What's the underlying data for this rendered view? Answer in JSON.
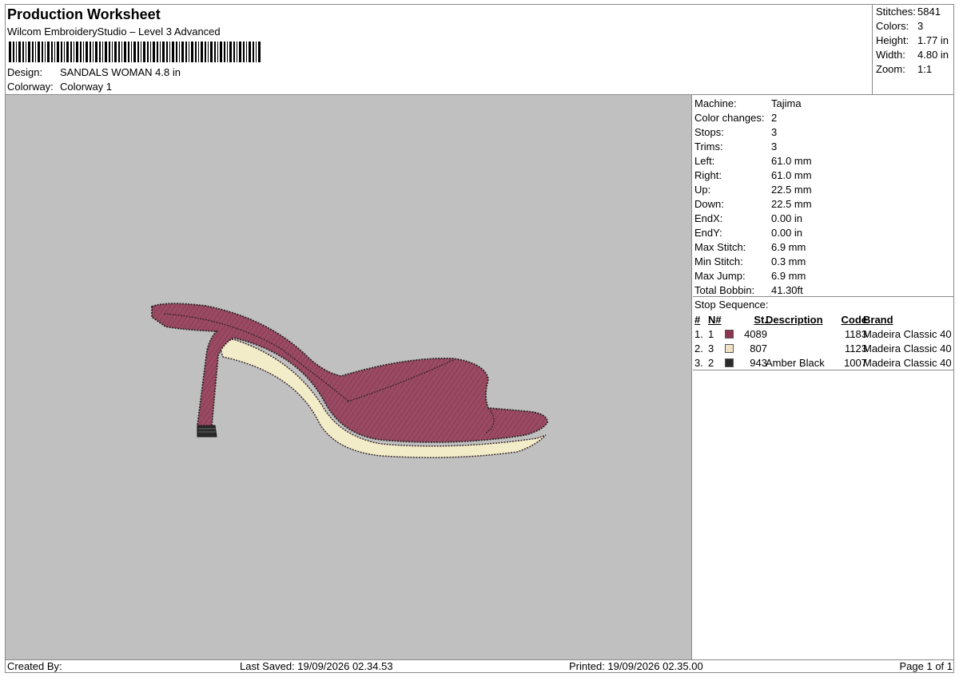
{
  "header": {
    "title": "Production Worksheet",
    "subtitle": "Wilcom EmbroideryStudio – Level 3 Advanced",
    "design_label": "Design:",
    "design_value": "SANDALS WOMAN 4.8 in",
    "colorway_label": "Colorway:",
    "colorway_value": "Colorway 1"
  },
  "summary": [
    {
      "label": "Stitches:",
      "value": "5841"
    },
    {
      "label": "Colors:",
      "value": "3"
    },
    {
      "label": "Height:",
      "value": "1.77 in"
    },
    {
      "label": "Width:",
      "value": "4.80 in"
    },
    {
      "label": "Zoom:",
      "value": "1:1"
    }
  ],
  "specs": [
    {
      "label": "Machine:",
      "value": "Tajima"
    },
    {
      "label": "Color changes:",
      "value": "2"
    },
    {
      "label": "Stops:",
      "value": "3"
    },
    {
      "label": "Trims:",
      "value": "3"
    },
    {
      "label": "Left:",
      "value": "61.0 mm"
    },
    {
      "label": "Right:",
      "value": "61.0 mm"
    },
    {
      "label": "Up:",
      "value": "22.5 mm"
    },
    {
      "label": "Down:",
      "value": "22.5 mm"
    },
    {
      "label": "EndX:",
      "value": "0.00 in"
    },
    {
      "label": "EndY:",
      "value": "0.00 in"
    },
    {
      "label": "Max Stitch:",
      "value": "6.9 mm"
    },
    {
      "label": "Min Stitch:",
      "value": "0.3 mm"
    },
    {
      "label": "Max Jump:",
      "value": "6.9 mm"
    },
    {
      "label": "Total Bobbin:",
      "value": "41.30ft"
    }
  ],
  "stop_sequence": {
    "title": "Stop Sequence:",
    "headers": {
      "idx": "#",
      "n": "N#",
      "st": "St.",
      "desc": "Description",
      "code": "Code",
      "brand": "Brand"
    },
    "rows": [
      {
        "idx": "1.",
        "n": "1",
        "color": "#8e3550",
        "st": "4089",
        "desc": "",
        "code": "1183",
        "brand": "Madeira Classic 40"
      },
      {
        "idx": "2.",
        "n": "3",
        "color": "#f0e2c6",
        "st": "807",
        "desc": "",
        "code": "1123",
        "brand": "Madeira Classic 40"
      },
      {
        "idx": "3.",
        "n": "2",
        "color": "#2a2a2a",
        "st": "943",
        "desc": "Amber Black",
        "code": "1007",
        "brand": "Madeira Classic 40"
      }
    ]
  },
  "footer": {
    "created_by": "Created By:",
    "last_saved": "Last Saved: 19/09/2026 02.34.53",
    "printed": "Printed: 19/09/2026 02.35.00",
    "page": "Page 1 of 1"
  },
  "colors": {
    "canvas_bg": "#c0c0c0",
    "shoe_body": "#9a4a62",
    "shoe_edge": "#3a2a2e",
    "sole_trim": "#f2ecc8",
    "heel_tip": "#2a2a2a"
  }
}
